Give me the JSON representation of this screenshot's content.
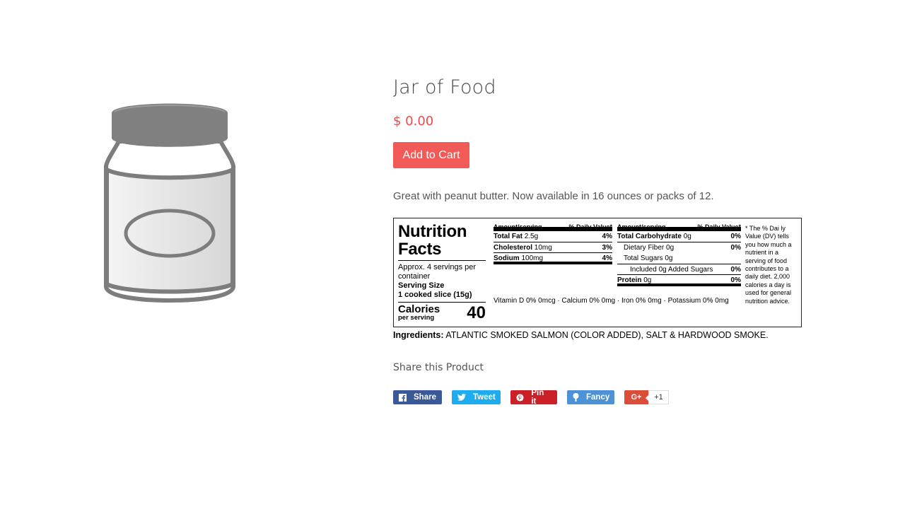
{
  "product": {
    "title": "Jar of Food",
    "price": "$ 0.00",
    "add_to_cart_label": "Add to Cart",
    "description": "Great with peanut butter. Now available in 16 ounces or packs of 12.",
    "image_icon": "jar-icon"
  },
  "nutrition": {
    "heading_line1": "Nutrition",
    "heading_line2": "Facts",
    "servings": "Approx. 4 servings per container",
    "serving_size_label": "Serving Size",
    "serving_size_value": "1 cooked slice (15g)",
    "calories_label": "Calories",
    "calories_sub": "per serving",
    "calories_value": "40",
    "header_amount": "Amount/serving",
    "header_dv": "% Daily Value*",
    "left_rows": [
      {
        "label": "Total Fat",
        "amount": "2.5g",
        "pct": "4%"
      },
      {
        "label": "Cholesterol",
        "amount": "10mg",
        "pct": "3%"
      },
      {
        "label": "Sodium",
        "amount": "100mg",
        "pct": "4%"
      }
    ],
    "right_rows": [
      {
        "label": "Total Carbohydrate",
        "amount": "0g",
        "pct": "0%"
      },
      {
        "label": "Dietary Fiber 0g",
        "amount": "",
        "pct": "0%"
      },
      {
        "label": "Total Sugars 0g",
        "amount": "",
        "pct": ""
      },
      {
        "label": "Included 0g Added Sugars",
        "amount": "",
        "pct": "0%"
      },
      {
        "label": "Protein",
        "amount": "0g",
        "pct": "0%"
      }
    ],
    "vitamins": "Vitamin D 0% 0mcg · Calcium 0% 0mg · Iron 0% 0mg · Potassium 0% 0mg",
    "footnote": "* The % Dai ly Value (DV) tells you how much a nutrient in a serving of food contributes to a daily diet. 2,000 calories a day is used for general nutrition advice."
  },
  "ingredients": {
    "label": "Ingredients:",
    "text": "ATLANTIC SMOKED SALMON (COLOR ADDED), SALT & HARDWOOD SMOKE."
  },
  "share": {
    "title": "Share this Product",
    "buttons": [
      {
        "label": "Share",
        "icon": "facebook-icon",
        "color": "#3b5998"
      },
      {
        "label": "Tweet",
        "icon": "twitter-icon",
        "color": "#1daced"
      },
      {
        "label": "Pin it",
        "icon": "pinterest-icon",
        "color": "#cb2027"
      },
      {
        "label": "Fancy",
        "icon": "fancy-icon",
        "color": "#4c92d4"
      }
    ],
    "gplus_label": "G+",
    "gplus_count": "+1",
    "gplus_color": "#dd4b39"
  },
  "colors": {
    "accent": "#f15a56",
    "price": "#ee4b4b"
  }
}
